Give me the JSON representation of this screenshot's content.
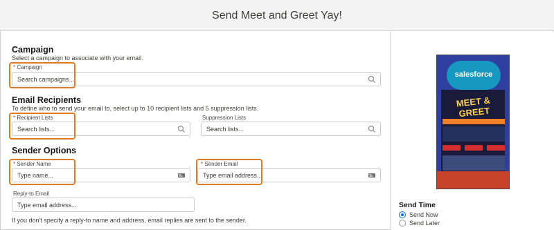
{
  "header": {
    "title": "Send Meet and Greet Yay!"
  },
  "campaign": {
    "title": "Campaign",
    "description": "Select a campaign to associate with your email.",
    "field_label": "Campaign",
    "placeholder": "Search campaigns..."
  },
  "recipients": {
    "title": "Email Recipients",
    "description": "To define who to send your email to, select up to 10 recipient lists and 5 suppression lists.",
    "recipient_label": "Recipient Lists",
    "recipient_placeholder": "Search lists...",
    "suppression_label": "Suppression Lists",
    "suppression_placeholder": "Search lists..."
  },
  "sender": {
    "title": "Sender Options",
    "name_label": "Sender Name",
    "name_placeholder": "Type name...",
    "email_label": "Sender Email",
    "email_placeholder": "Type email address...",
    "reply_label": "Reply-to Email",
    "reply_placeholder": "Type email address...",
    "helper": "If you don't specify a reply-to name and address, email replies are sent to the sender."
  },
  "preview": {
    "logo_text": "salesforce",
    "headline": "MEET & GREET"
  },
  "send_time": {
    "title": "Send Time",
    "options": [
      "Send Now",
      "Send Later"
    ],
    "selected": "Send Now"
  },
  "colors": {
    "accent_highlight": "#e07b24",
    "radio_selected": "#0070d2",
    "required_asterisk": "#c23934"
  }
}
